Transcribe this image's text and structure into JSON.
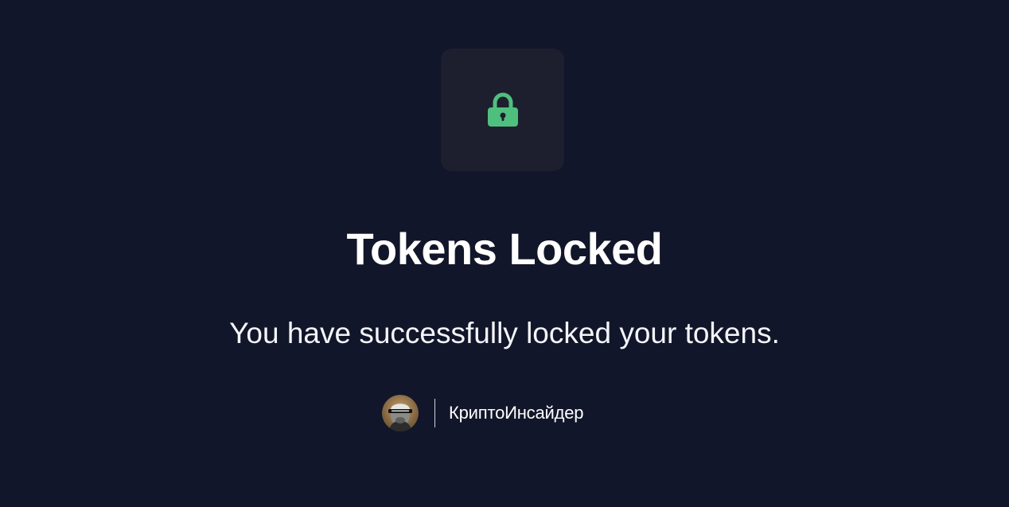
{
  "dialog": {
    "icon": "lock-icon",
    "icon_color": "#4fbf7e",
    "title": "Tokens Locked",
    "message": "You have successfully locked your tokens."
  },
  "branding": {
    "avatar_icon": "avatar",
    "name": "КриптоИнсайдер"
  },
  "colors": {
    "background": "#12162a",
    "tile": "#1d1f2f",
    "text": "#ffffff"
  }
}
